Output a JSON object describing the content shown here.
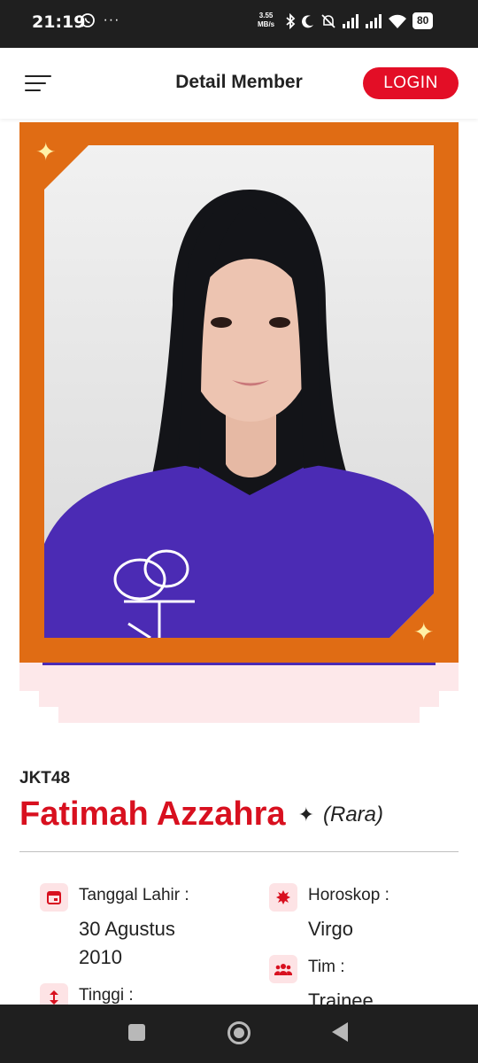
{
  "status_bar": {
    "time": "21:19",
    "left_icons": "whatsapp-icon, more-dots",
    "speed_value": "3.55",
    "speed_unit": "MB/s",
    "battery": "80"
  },
  "header": {
    "title": "Detail Member",
    "login_label": "LOGIN"
  },
  "member": {
    "group": "JKT48",
    "name": "Fatimah Azzahra",
    "nickname": "(Rara)"
  },
  "details": {
    "birth_label": "Tanggal Lahir :",
    "birth_value": "30 Agustus 2010",
    "horoscope_label": "Horoskop :",
    "horoscope_value": "Virgo",
    "height_label": "Tinggi :",
    "team_label": "Tim :",
    "team_value": "Trainee"
  },
  "colors": {
    "accent_red": "#e30e26",
    "frame_orange": "#e06c14",
    "shirt_purple": "#4b2bb4",
    "pink_tint": "#fde8ea"
  }
}
